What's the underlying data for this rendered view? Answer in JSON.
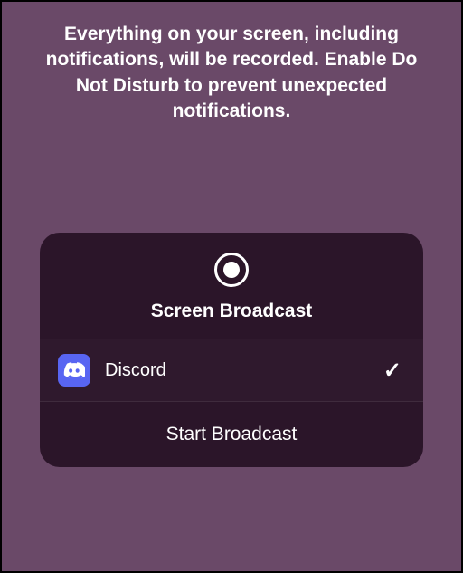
{
  "warning": {
    "text": "Everything on your screen, including notifications, will be recorded. Enable Do Not Disturb to prevent unexpected notifications."
  },
  "card": {
    "title": "Screen Broadcast",
    "app": {
      "name": "Discord",
      "selected": true
    },
    "action_label": "Start Broadcast"
  }
}
